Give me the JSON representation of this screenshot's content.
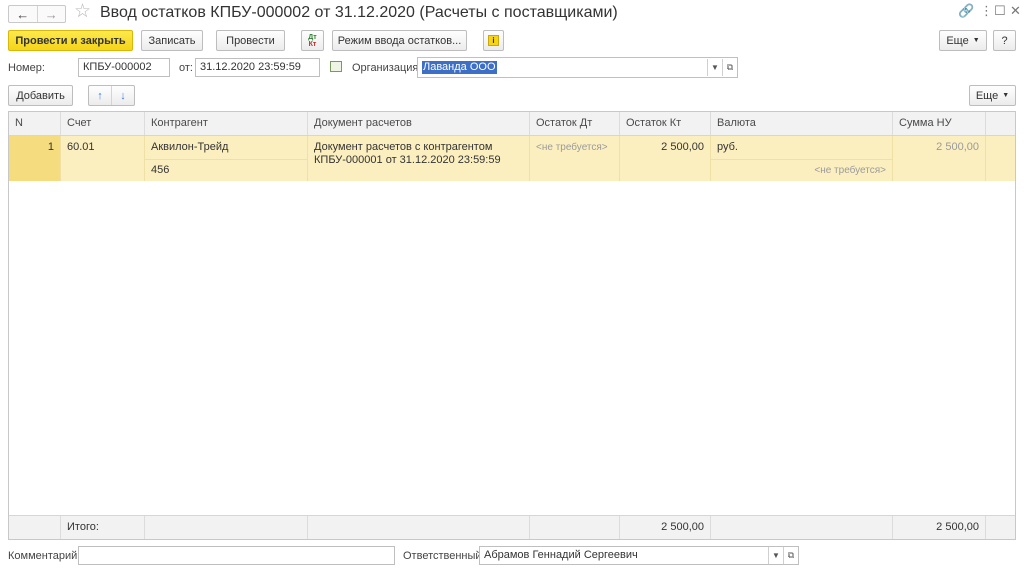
{
  "window": {
    "title": "Ввод остатков КПБУ-000002 от 31.12.2020 (Расчеты с поставщиками)",
    "nav_back": "←",
    "nav_forward": "→",
    "star": "☆",
    "link_icon": "🔗",
    "menu_icon": "⋮",
    "restore_icon": "☐",
    "close_icon": "✕"
  },
  "toolbar": {
    "post_and_close": "Провести и закрыть",
    "save": "Записать",
    "post": "Провести",
    "dt_kt_top": "Дт",
    "dt_kt_bottom": "Кт",
    "input_mode": "Режим ввода остатков...",
    "info_icon": "i",
    "more": "Еще",
    "help": "?"
  },
  "header": {
    "number_label": "Номер:",
    "number_value": "КПБУ-000002",
    "date_label": "от:",
    "date_value": "31.12.2020 23:59:59",
    "org_label": "Организация:",
    "org_value": "Лаванда ООО"
  },
  "table_toolbar": {
    "add": "Добавить",
    "up": "↑",
    "down": "↓",
    "more": "Еще"
  },
  "table": {
    "columns": [
      "N",
      "Счет",
      "Контрагент",
      "Документ расчетов",
      "Остаток Дт",
      "Остаток Кт",
      "Валюта",
      "Сумма НУ"
    ],
    "rows": [
      {
        "n": "1",
        "account": "60.01",
        "counterparty": "Аквилон-Трейд",
        "contract": "456",
        "doc_line1": "Документ расчетов с контрагентом",
        "doc_line2": "КПБУ-000001 от 31.12.2020 23:59:59",
        "debit": "<не требуется>",
        "credit": "2 500,00",
        "currency": "руб.",
        "currency_sub": "<не требуется>",
        "sum_nu": "2 500,00"
      }
    ],
    "footer": {
      "total_label": "Итого:",
      "credit_total": "2 500,00",
      "sum_nu_total": "2 500,00"
    }
  },
  "bottom": {
    "comment_label": "Комментарий:",
    "comment_value": "",
    "responsible_label": "Ответственный:",
    "responsible_value": "Абрамов Геннадий Сергеевич"
  },
  "colors": {
    "primary_button": "#f5d419",
    "row_selected": "#fbefc0",
    "focus_border": "#e8c443",
    "selection": "#3d6fc6"
  }
}
